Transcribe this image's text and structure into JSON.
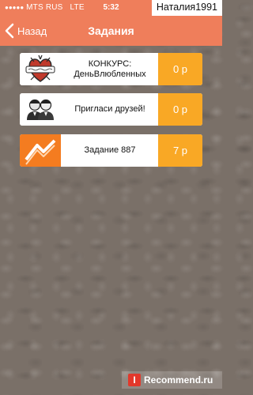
{
  "status_bar": {
    "carrier": "MTS RUS",
    "network": "LTE",
    "time": "5:32"
  },
  "username": "Наталия1991",
  "navbar": {
    "back_label": "Назад",
    "title": "Задания"
  },
  "tasks": [
    {
      "label": "КОНКУРС: ДеньВлюбленных",
      "reward": "0 р",
      "icon": "heart-tattoo-icon"
    },
    {
      "label": "Пригласи друзей!",
      "reward": "0 р",
      "icon": "friends-avatars-icon"
    },
    {
      "label": "Задание 887",
      "reward": "7 р",
      "icon": "orange-logo-icon"
    }
  ],
  "watermark": "Recommend.ru",
  "colors": {
    "header": "#ef7e5b",
    "reward": "#f9a825",
    "background": "#7a7068"
  }
}
